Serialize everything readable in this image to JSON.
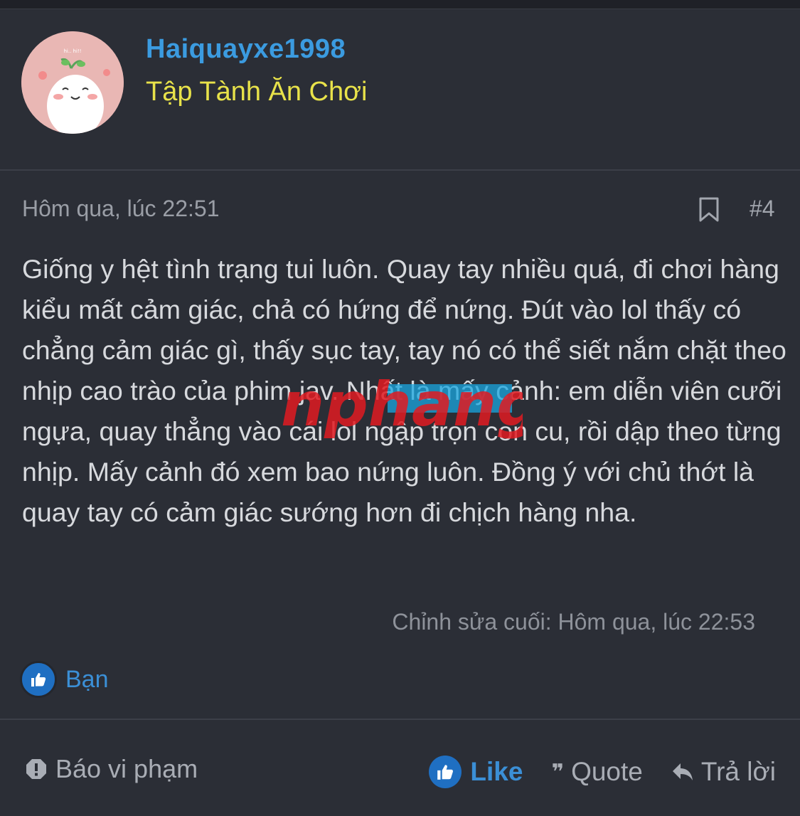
{
  "header": {
    "username": "Haiquayxe1998",
    "user_title": "Tập Tành Ăn Chơi",
    "avatar_text": "hi.. hi!!"
  },
  "post": {
    "date": "Hôm qua, lúc 22:51",
    "number": "#4",
    "content": "Giống y hệt tình trạng tui luôn. Quay tay nhiều quá, đi chơi hàng kiểu mất cảm giác, chả có hứng để nứng. Đút vào lol thấy có chẳng cảm giác gì, thấy sục tay, tay nó có thể siết nắm chặt theo nhịp cao trào của phim jav. Nhất là mấy cảnh: em diễn viên cưỡi ngựa, quay thẳng vào cái lol ngập trọn con cu, rồi dập theo từng nhịp. Mấy cảnh đó xem bao nứng luôn. Đồng ý với chủ thớt là quay tay có cảm giác sướng hơn đi chịch hàng nha.",
    "edited": "Chỉnh sửa cuối: Hôm qua, lúc 22:53",
    "watermark": "nphang"
  },
  "reactions": {
    "label": "Bạn"
  },
  "footer": {
    "report_label": "Báo vi phạm",
    "like_label": "Like",
    "quote_label": "Quote",
    "reply_label": "Trả lời"
  },
  "colors": {
    "background": "#2b2e36",
    "username": "#3b9be0",
    "user_title": "#e8e24a",
    "accent": "#1f6fc2"
  },
  "icons": [
    "bookmark-icon",
    "thumbs-up-icon",
    "alert-icon",
    "quote-icon",
    "reply-icon"
  ]
}
